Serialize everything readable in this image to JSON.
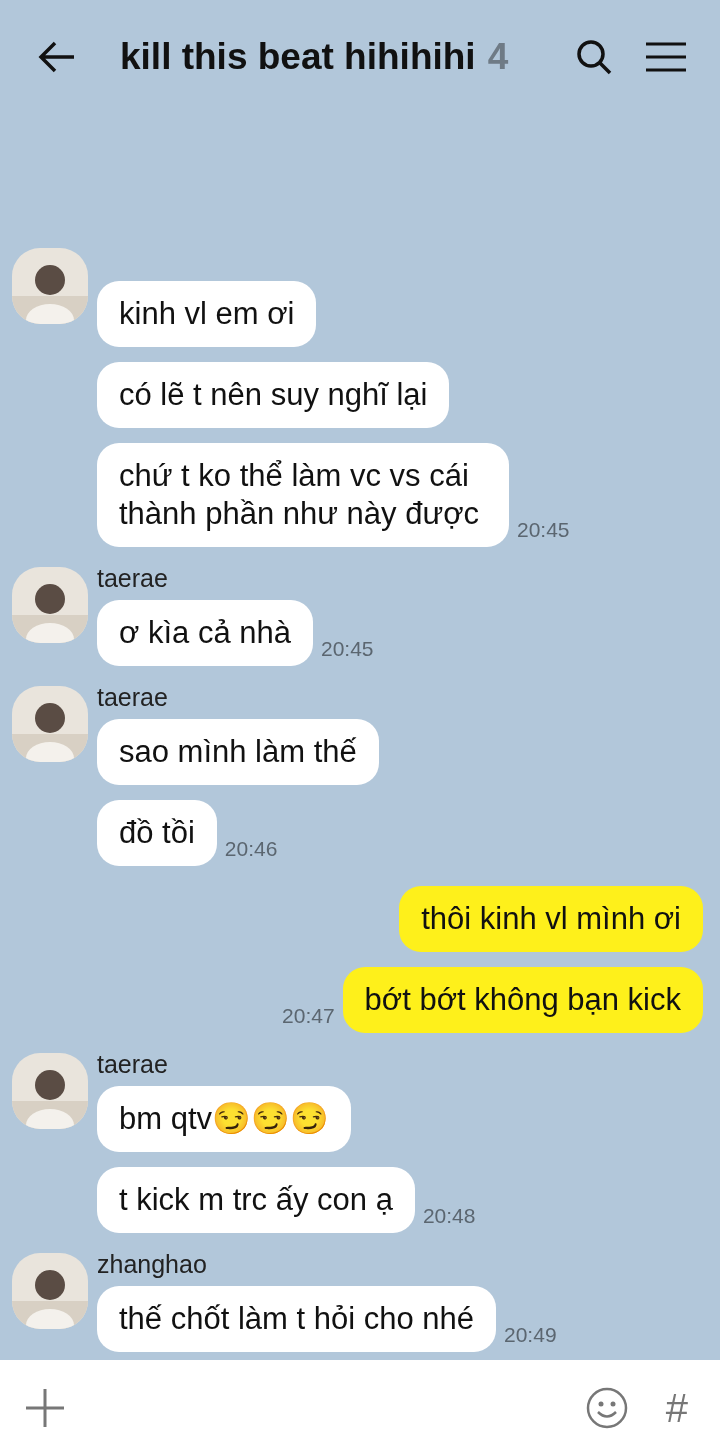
{
  "header": {
    "title": "kill this beat hihihihi",
    "member_count": "4"
  },
  "groups": [
    {
      "kind": "received",
      "bubbles": [
        "kinh vl em ơi",
        "có lẽ t nên suy nghĩ lại",
        "chứ t ko thể làm vc vs cái thành phần như này được"
      ],
      "time": "20:45"
    },
    {
      "kind": "received",
      "sender": "taerae",
      "bubbles": [
        "ơ kìa cả nhà"
      ],
      "time": "20:45"
    },
    {
      "kind": "received",
      "sender": "taerae",
      "bubbles": [
        "sao mình làm thế",
        "đồ tồi"
      ],
      "time": "20:46"
    },
    {
      "kind": "sent",
      "bubbles": [
        "thôi kinh vl mình ơi",
        "bớt bớt không bạn kick"
      ],
      "time": "20:47"
    },
    {
      "kind": "received",
      "sender": "taerae",
      "bubbles": [
        "bm qtv😏😏😏",
        "t kick m trc ấy con ạ"
      ],
      "time": "20:48"
    },
    {
      "kind": "received",
      "sender": "zhanghao",
      "bubbles": [
        "thế chốt làm t hỏi cho nhé"
      ],
      "time": "20:49"
    }
  ],
  "input_bar": {
    "hash": "#"
  }
}
